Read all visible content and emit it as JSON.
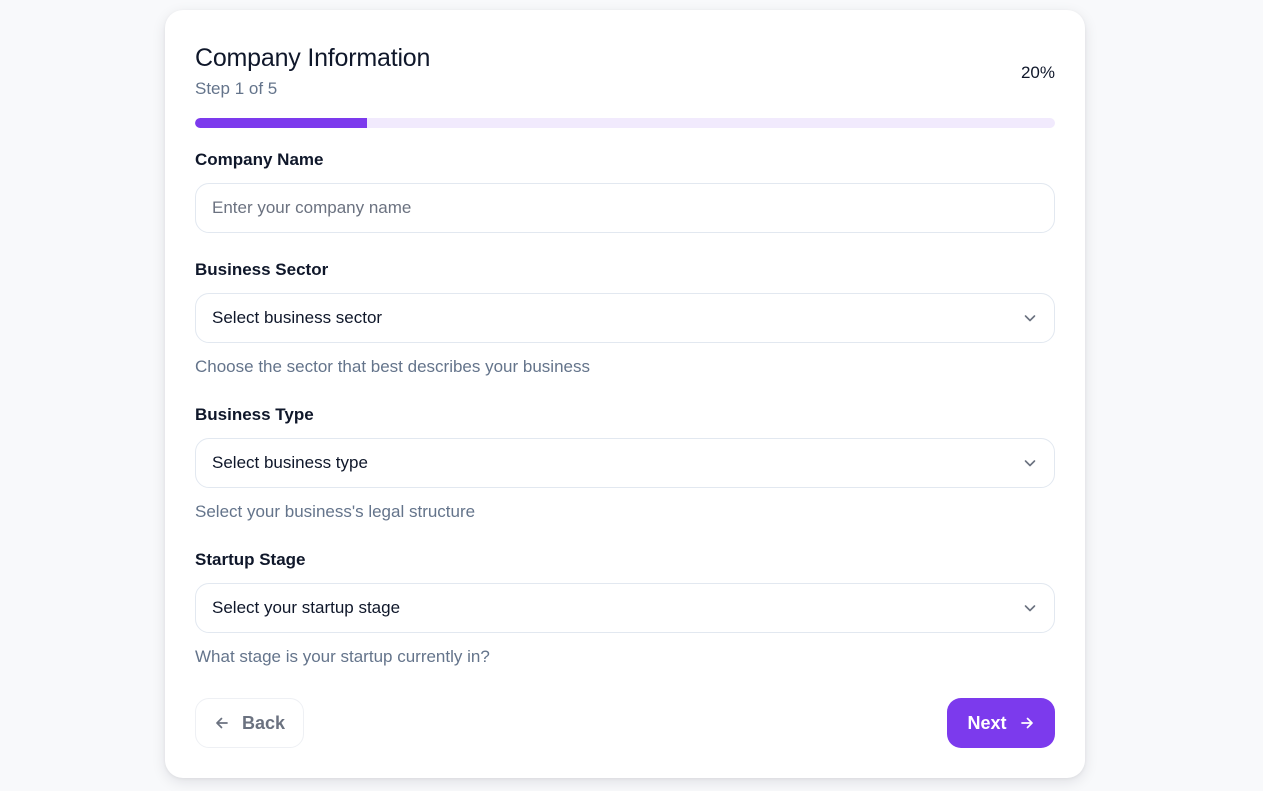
{
  "header": {
    "title": "Company Information",
    "step_text": "Step 1 of 5",
    "percent_text": "20%",
    "progress": 0.2
  },
  "fields": {
    "company_name": {
      "label": "Company Name",
      "value": "",
      "placeholder": "Enter your company name"
    },
    "business_sector": {
      "label": "Business Sector",
      "selected": "Select business sector",
      "help": "Choose the sector that best describes your business"
    },
    "business_type": {
      "label": "Business Type",
      "selected": "Select business type",
      "help": "Select your business's legal structure"
    },
    "startup_stage": {
      "label": "Startup Stage",
      "selected": "Select your startup stage",
      "help": "What stage is your startup currently in?"
    }
  },
  "footer": {
    "back_label": "Back",
    "next_label": "Next"
  },
  "icons": {
    "select_chevron": "chevron-down-icon",
    "back": "arrow-left-icon",
    "next": "arrow-right-icon"
  },
  "colors": {
    "accent": "#7c3aed",
    "progress_track": "#f1eafd",
    "page_background": "#f8f9fb"
  }
}
